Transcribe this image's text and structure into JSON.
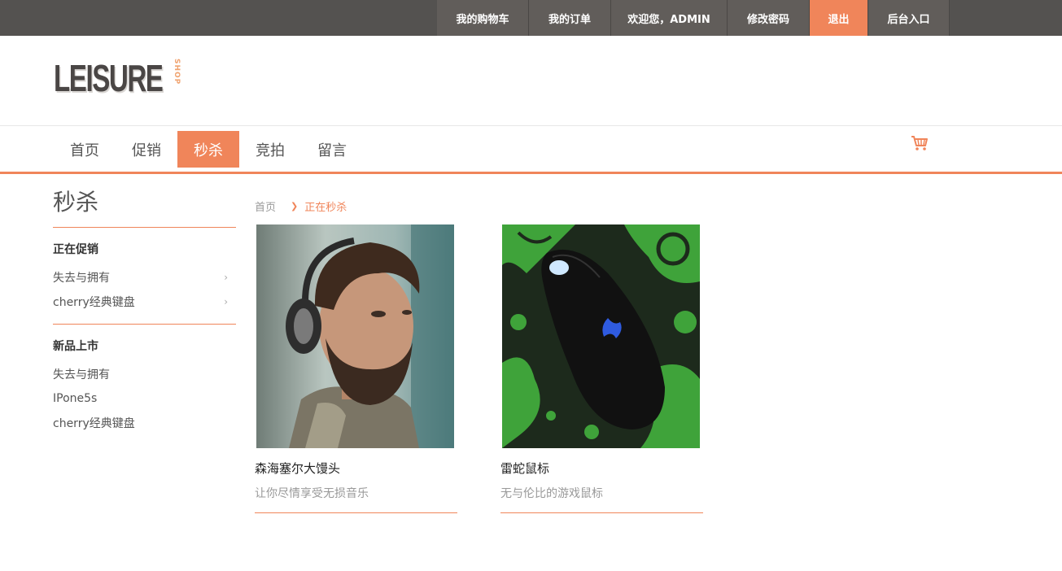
{
  "topnav": {
    "items": [
      {
        "label": "我的购物车"
      },
      {
        "label": "我的订单"
      },
      {
        "label": "欢迎您，ADMIN"
      },
      {
        "label": "修改密码"
      },
      {
        "label": "退出"
      },
      {
        "label": "后台入口"
      }
    ],
    "active_index": 4
  },
  "logo": {
    "main": "LEISURE",
    "sub": "SHOP"
  },
  "mainnav": {
    "items": [
      {
        "label": "首页"
      },
      {
        "label": "促销"
      },
      {
        "label": "秒杀"
      },
      {
        "label": "竞拍"
      },
      {
        "label": "留言"
      }
    ],
    "active_index": 2,
    "cart_icon": "shopping-cart-icon"
  },
  "sidebar": {
    "title": "秒杀",
    "groups": [
      {
        "heading": "正在促销",
        "items": [
          {
            "label": "失去与拥有",
            "icon": "chevron-right-icon"
          },
          {
            "label": "cherry经典键盘",
            "icon": "chevron-right-icon"
          }
        ]
      },
      {
        "heading": "新品上市",
        "items": [
          {
            "label": "失去与拥有"
          },
          {
            "label": "IPone5s"
          },
          {
            "label": "cherry经典键盘"
          }
        ]
      }
    ]
  },
  "breadcrumb": {
    "home": "首页",
    "current": "正在秒杀",
    "separator_icon": "chevron-right-icon"
  },
  "products": [
    {
      "name": "森海塞尔大馒头",
      "desc": "让你尽情享受无损音乐",
      "image": "man-with-headphones-photo"
    },
    {
      "name": "雷蛇鼠标",
      "desc": "无与伦比的游戏鼠标",
      "image": "razer-gaming-mouse-photo"
    }
  ],
  "colors": {
    "accent": "#f0855a",
    "topbar": "#545250",
    "text": "#333333"
  }
}
